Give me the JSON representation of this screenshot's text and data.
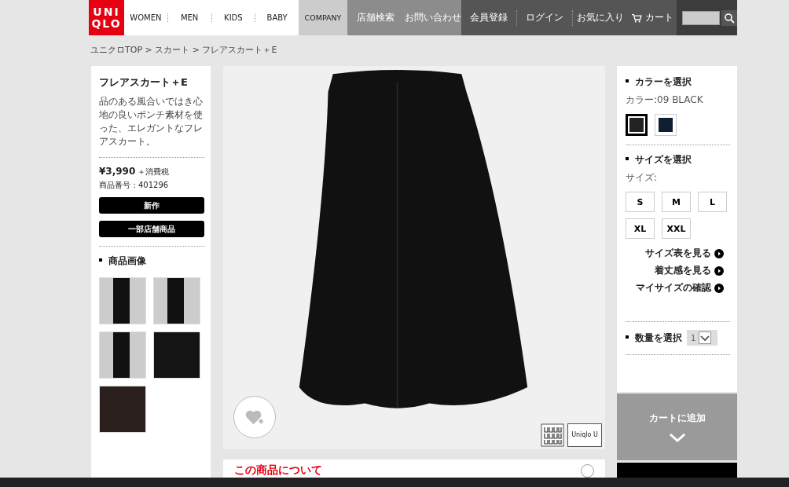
{
  "header": {
    "logo": [
      "UNI",
      "QLO"
    ],
    "nav_main": [
      "WOMEN",
      "MEN",
      "KIDS",
      "BABY"
    ],
    "nav_company": [
      "COMPANY"
    ],
    "nav_info": [
      "店舗検索",
      "お問い合わせ"
    ],
    "nav_user": [
      "会員登録",
      "ログイン",
      "お気に入り"
    ],
    "cart": "カート"
  },
  "breadcrumb": "ユニクロTOP > スカート > フレアスカート＋E",
  "product": {
    "name": "フレアスカート＋E",
    "description": "品のある風合いではき心地の良いポンチ素材を使った、エレガントなフレアスカート。",
    "price": "¥3,990",
    "tax": "＋消費税",
    "number": "商品番号：401296",
    "tags": [
      "新作",
      "一部店舗商品"
    ],
    "images_heading": "商品画像",
    "thumbnails": [
      {
        "kind": "model"
      },
      {
        "kind": "model"
      },
      {
        "kind": "model"
      },
      {
        "kind": "detail"
      },
      {
        "kind": "label"
      }
    ]
  },
  "main_image": {
    "badge": "Uniqlo U"
  },
  "about_heading": "この商品について",
  "options": {
    "color_heading": "カラーを選択",
    "color_label": "カラー:09 BLACK",
    "colors": [
      {
        "color": "#222222",
        "selected": true
      },
      {
        "color": "#0f1e33",
        "selected": false
      }
    ],
    "size_heading": "サイズを選択",
    "size_label": "サイズ:",
    "sizes": [
      {
        "label": "S",
        "selected": false
      },
      {
        "label": "M",
        "selected": false
      },
      {
        "label": "L",
        "selected": false
      },
      {
        "label": "XL",
        "selected": false
      },
      {
        "label": "XXL",
        "selected": false
      }
    ],
    "links": [
      "サイズ表を見る",
      "着丈感を見る",
      "マイサイズの確認"
    ],
    "quantity_heading": "数量を選択",
    "quantity": "1",
    "add_to_cart": "カートに追加"
  }
}
